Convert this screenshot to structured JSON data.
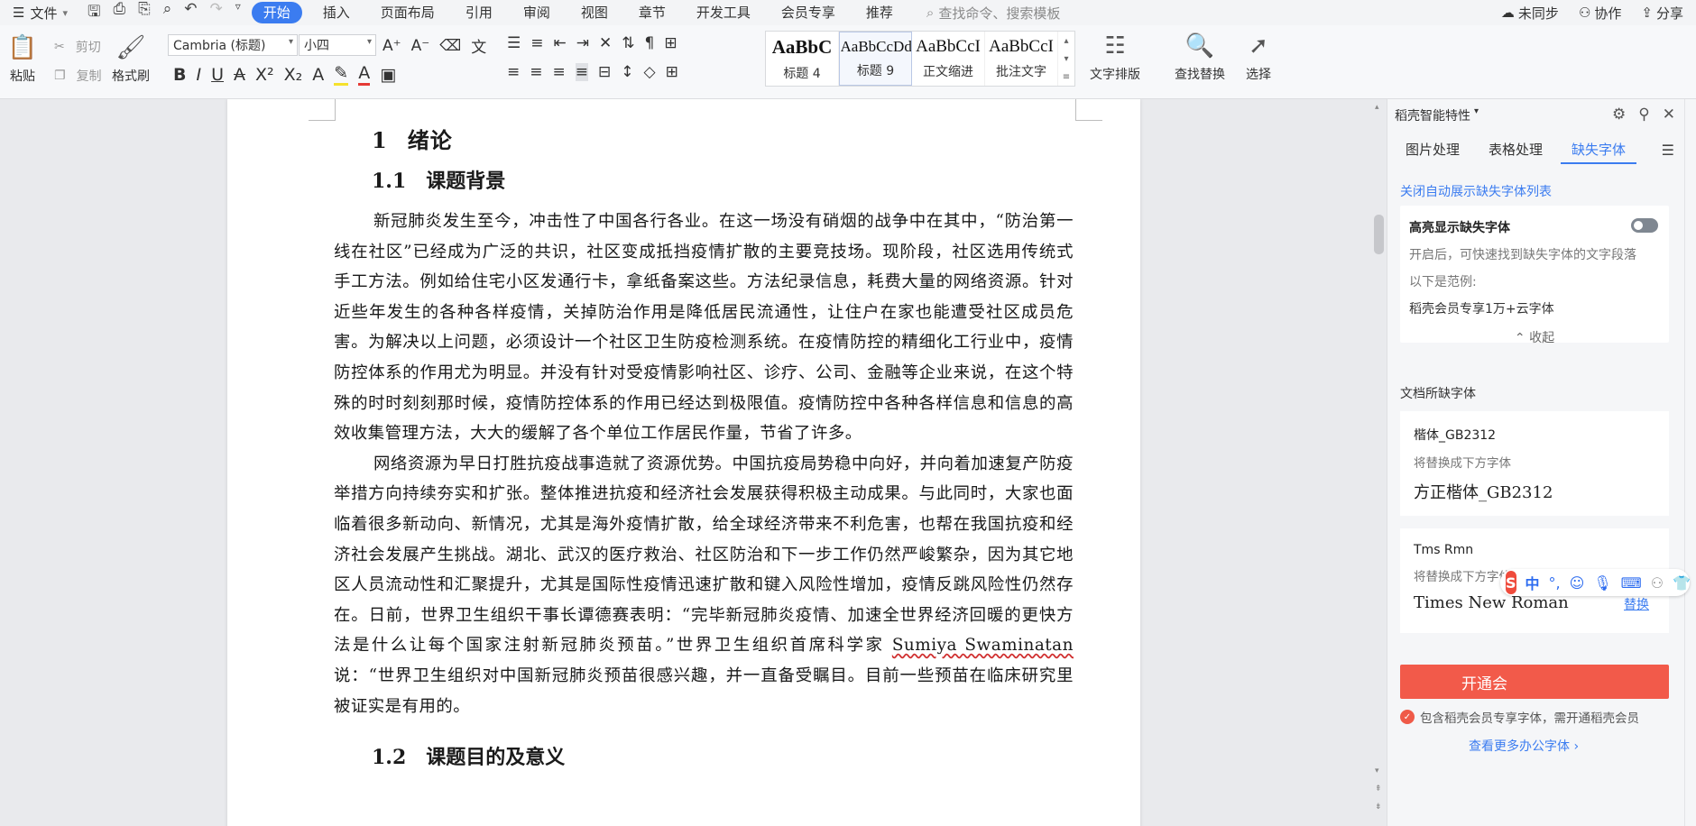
{
  "menu": {
    "file_label": "文件",
    "tabs": [
      "开始",
      "插入",
      "页面布局",
      "引用",
      "审阅",
      "视图",
      "章节",
      "开发工具",
      "会员专享",
      "推荐"
    ],
    "active_tab": "开始",
    "search_placeholder": "查找命令、搜索模板",
    "right": {
      "sync": "未同步",
      "collab": "协作",
      "share": "分享"
    }
  },
  "ribbon": {
    "paste": "粘贴",
    "cut": "剪切",
    "copy": "复制",
    "format_painter": "格式刷",
    "font_name": "Cambria (标题)",
    "font_size": "小四",
    "styles": [
      {
        "preview": "AaBbC",
        "label": "标题 4"
      },
      {
        "preview": "AaBbCcDd",
        "label": "标题 9"
      },
      {
        "preview": "AaBbCcI",
        "label": "正文缩进"
      },
      {
        "preview": "AaBbCcI",
        "label": "批注文字"
      }
    ],
    "text_layout": "文字排版",
    "find_replace": "查找替换",
    "select": "选择"
  },
  "document": {
    "h1_num": "1",
    "h1_text": "绪论",
    "h2_num": "1.1",
    "h2_text": "课题背景",
    "para1": "新冠肺炎发生至今，冲击性了中国各行各业。在这一场没有硝烟的战争中在其中，“防治第一线在社区”已经成为广泛的共识，社区变成抵挡疫情扩散的主要竞技场。现阶段，社区选用传统式手工方法。例如给住宅小区发通行卡，拿纸备案这些。方法纪录信息，耗费大量的网络资源。针对近些年发生的各种各样疫情，关掉防治作用是降低居民流通性，让住户在家也能遭受社区成员危害。为解决以上问题，必须设计一个社区卫生防疫检测系统。在疫情防控的精细化工行业中，疫情防控体系的作用尤为明显。并没有针对受疫情影响社区、诊疗、公司、金融等企业来说，在这个特殊的时时刻刻那时候，疫情防控体系的作用已经达到极限值。疫情防控中各种各样信息和信息的高效收集管理方法，大大的缓解了各个单位工作居民作量，节省了许多。",
    "para2_a": "网络资源为早日打胜抗疫战事造就了资源优势。中国抗疫局势稳中向好，并向着加速复产防疫举措方向持续夯实和扩张。整体推进抗疫和经济社会发展获得积极主动成果。与此同时，大家也面临着很多新动向、新情况，尤其是海外疫情扩散，给全球经济带来不利危害，也帮在我国抗疫和经济社会发展产生挑战。湖北、武汉的医疗救治、社区防治和下一步工作仍然严峻繁杂，因为其它地区人员流动性和汇聚提升，尤其是国际性疫情迅速扩散和键入风险性增加，疫情反跳风险性仍然存在。日前，世界卫生组织干事长谭德赛表明：“完毕新冠肺炎疫情、加速全世界经济回暖的更快方法是什么让每个国家注射新冠肺炎预苗。”世界卫生组织首席科学家 ",
    "para2_name": "Sumiya Swaminatan",
    "para2_b": " 说：“世界卫生组织对中国新冠肺炎预苗很感兴趣，并一直备受瞩目。目前一些预苗在临床研究里被证实是有用的。",
    "h2b_num": "1.2",
    "h2b_text": "课题目的及意义"
  },
  "panel": {
    "title": "稻壳智能特性",
    "tabs": [
      "图片处理",
      "表格处理",
      "缺失字体"
    ],
    "active_tab": "缺失字体",
    "close_auto_link": "关闭自动展示缺失字体列表",
    "highlight_title": "高亮显示缺失字体",
    "highlight_desc": "开启后，可快速找到缺失字体的文字段落",
    "example_label": "以下是范例:",
    "example_text": "稻壳会员专享1万+云字体",
    "collapse": "收起",
    "missing_title": "文档所缺字体",
    "fonts": [
      {
        "name": "楷体_GB2312",
        "replace_label": "将替换成下方字体",
        "target": "方正楷体_GB2312"
      },
      {
        "name": "Tms Rmn",
        "replace_label": "将替换成下方字体",
        "target": "Times New Roman",
        "action": "替换"
      }
    ],
    "open_button": "开通会",
    "note": "包含稻壳会员专享字体，需开通稻壳会员",
    "more_link": "查看更多办公字体"
  },
  "ime": {
    "logo": "S",
    "mode": "中",
    "punct": "°,"
  }
}
